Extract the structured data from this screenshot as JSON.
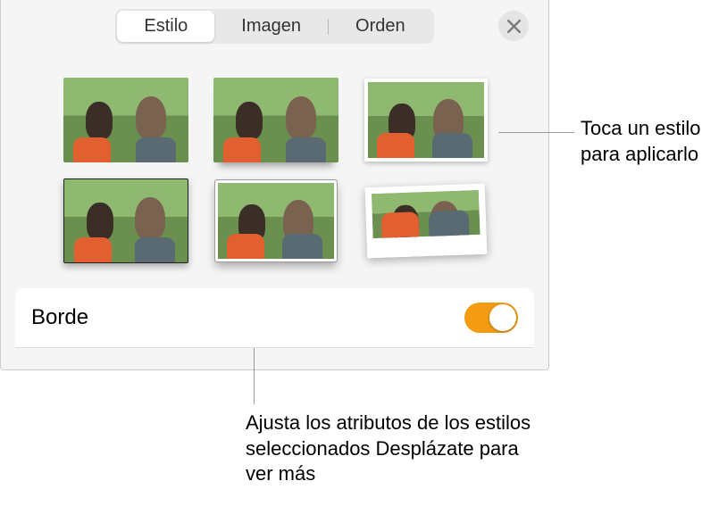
{
  "tabs": {
    "style": "Estilo",
    "image": "Imagen",
    "order": "Orden"
  },
  "border": {
    "label": "Borde",
    "on": true
  },
  "callouts": {
    "apply": "Toca un estilo para aplicarlo",
    "adjust": "Ajusta los atributos de los estilos seleccionados Desplázate para ver más"
  }
}
